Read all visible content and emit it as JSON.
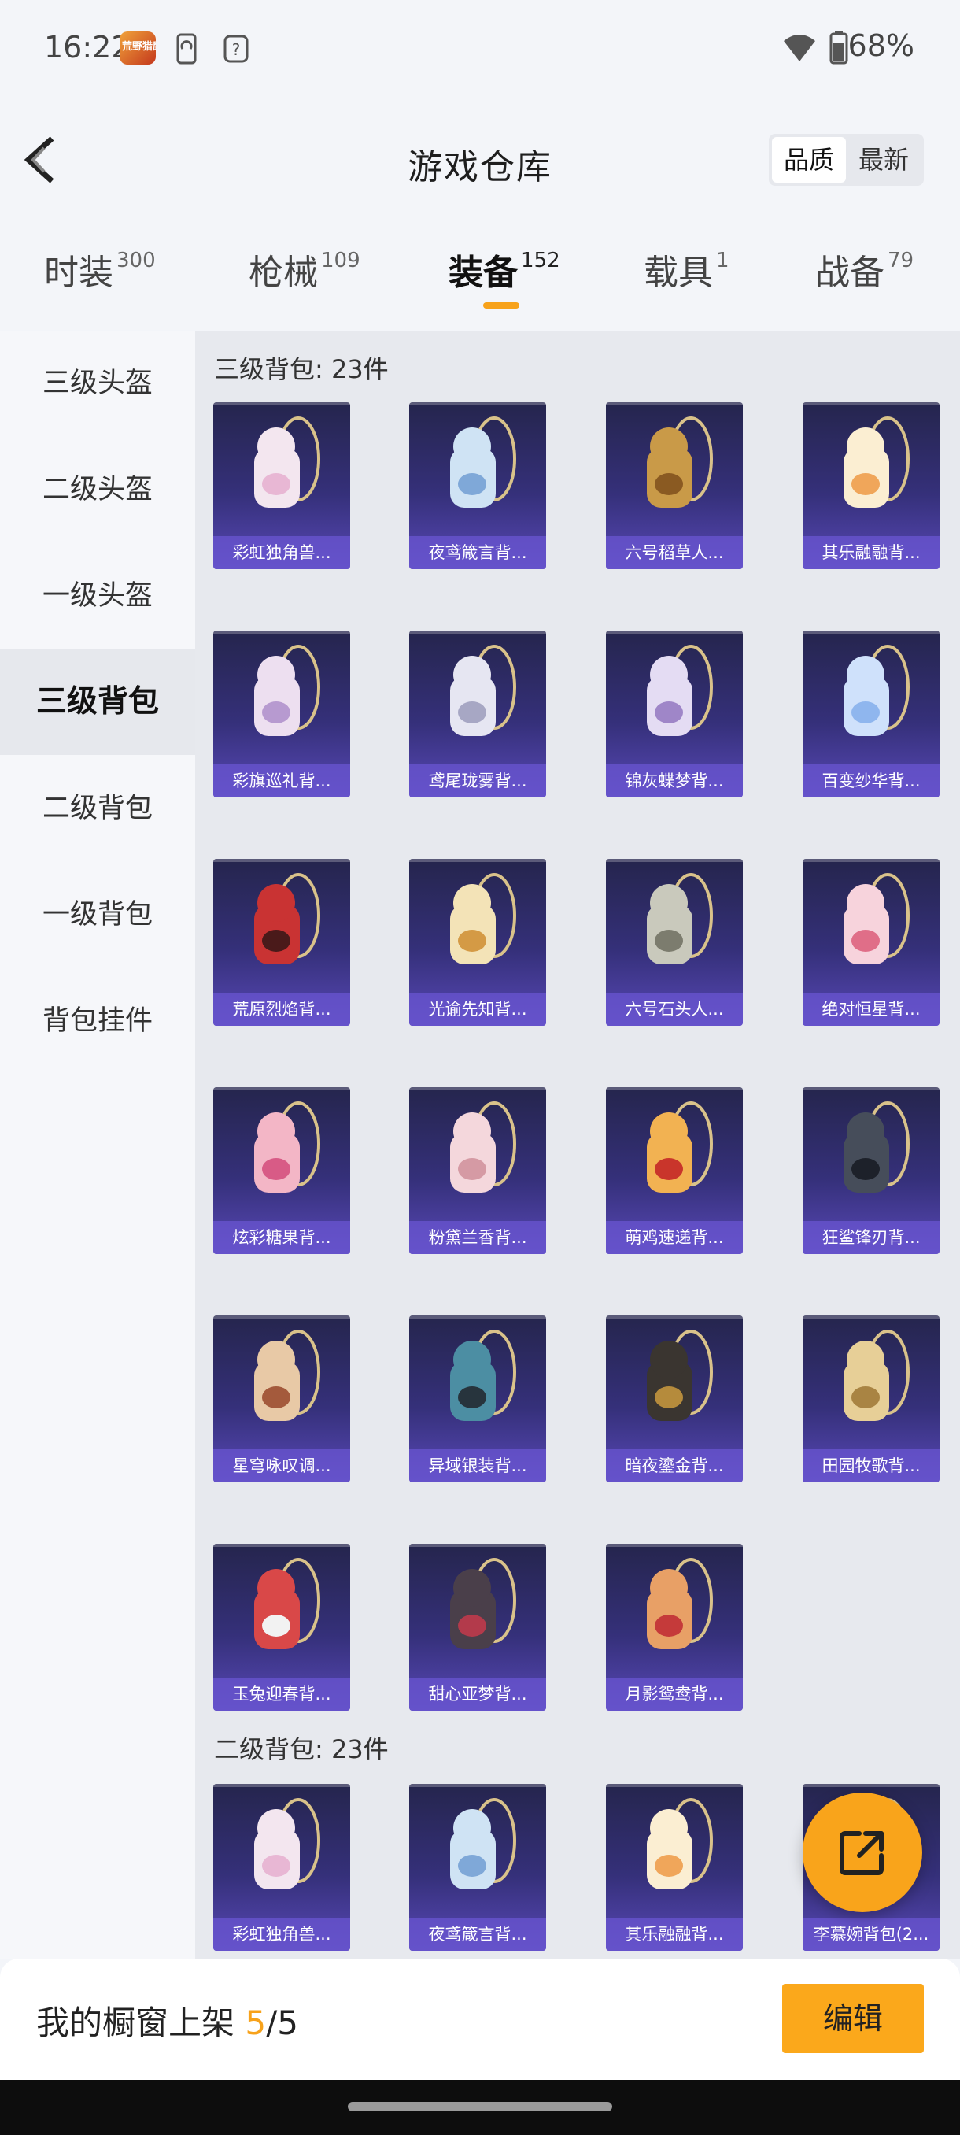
{
  "status_bar": {
    "time": "16:22",
    "app_icon_text": "荒野猎鹰",
    "battery": "68%"
  },
  "header": {
    "title": "游戏仓库",
    "sort_options": [
      "品质",
      "最新"
    ]
  },
  "tabs": [
    {
      "label": "时装",
      "count": "300"
    },
    {
      "label": "枪械",
      "count": "109"
    },
    {
      "label": "装备",
      "count": "152",
      "active": true
    },
    {
      "label": "载具",
      "count": "1"
    },
    {
      "label": "战备",
      "count": "79"
    }
  ],
  "sidebar": {
    "items": [
      "三级头盔",
      "二级头盔",
      "一级头盔",
      "三级背包",
      "二级背包",
      "一级背包",
      "背包挂件"
    ],
    "active_index": 3
  },
  "sections": [
    {
      "header": "三级背包: 23件",
      "items": [
        {
          "name": "彩虹独角兽...",
          "art": "unicorn-backpack"
        },
        {
          "name": "夜鸢箴言背...",
          "art": "jellyfish-backpack"
        },
        {
          "name": "六号稻草人...",
          "art": "scarecrow-backpack"
        },
        {
          "name": "其乐融融背...",
          "art": "cake-backpack"
        },
        {
          "name": "彩旗巡礼背...",
          "art": "bow-backpack"
        },
        {
          "name": "鸢尾珑雾背...",
          "art": "crystal-backpack"
        },
        {
          "name": "锦灰蝶梦背...",
          "art": "butterfly-backpack"
        },
        {
          "name": "百变纱华背...",
          "art": "flower-backpack"
        },
        {
          "name": "荒原烈焰背...",
          "art": "flame-backpack"
        },
        {
          "name": "光谕先知背...",
          "art": "wing-backpack"
        },
        {
          "name": "六号石头人...",
          "art": "stone-backpack"
        },
        {
          "name": "绝对恒星背...",
          "art": "popcorn-backpack"
        },
        {
          "name": "炫彩糖果背...",
          "art": "donut-backpack"
        },
        {
          "name": "粉黛兰香背...",
          "art": "pink-backpack"
        },
        {
          "name": "萌鸡速递背...",
          "art": "chick-backpack"
        },
        {
          "name": "狂鲨锋刃背...",
          "art": "shark-backpack"
        },
        {
          "name": "星穹咏叹调...",
          "art": "bunny-backpack"
        },
        {
          "name": "异域银装背...",
          "art": "tactical-backpack"
        },
        {
          "name": "暗夜鎏金背...",
          "art": "dark-backpack"
        },
        {
          "name": "田园牧歌背...",
          "art": "basket-backpack"
        },
        {
          "name": "玉兔迎春背...",
          "art": "red-backpack"
        },
        {
          "name": "甜心亚梦背...",
          "art": "quilted-backpack"
        },
        {
          "name": "月影鸳鸯背...",
          "art": "bird-backpack"
        }
      ]
    },
    {
      "header": "二级背包: 23件",
      "items": [
        {
          "name": "彩虹独角兽...",
          "art": "unicorn-backpack"
        },
        {
          "name": "夜鸢箴言背...",
          "art": "jellyfish-backpack"
        },
        {
          "name": "其乐融融背...",
          "art": "cake-backpack"
        },
        {
          "name": "李慕婉背包(2...",
          "art": "pink-backpack"
        }
      ]
    }
  ],
  "bottom_bar": {
    "label": "我的橱窗上架",
    "current": "5",
    "total": "/5",
    "edit_label": "编辑"
  },
  "colors": {
    "accent": "#F7A21B",
    "card_bg_top": "#25254D",
    "card_bg_bottom": "#5848B6"
  },
  "icons": [
    "back-icon",
    "share-icon",
    "wifi-icon",
    "battery-icon",
    "phone-sync-icon",
    "help-icon"
  ]
}
